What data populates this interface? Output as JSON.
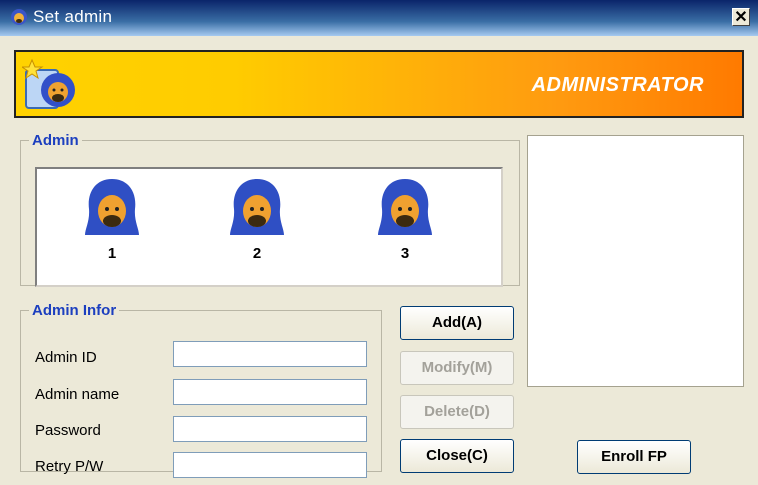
{
  "window": {
    "title": "Set admin",
    "close_glyph": "✕"
  },
  "banner": {
    "text": "ADMINISTRATOR",
    "icon": "admin-user-icon"
  },
  "admin_group": {
    "legend": "Admin",
    "items": [
      {
        "number": "1",
        "icon": "hooded-user-icon"
      },
      {
        "number": "2",
        "icon": "hooded-user-icon"
      },
      {
        "number": "3",
        "icon": "hooded-user-icon"
      }
    ]
  },
  "info_group": {
    "legend": "Admin Infor",
    "fields": [
      {
        "label": "Admin ID",
        "value": ""
      },
      {
        "label": "Admin name",
        "value": ""
      },
      {
        "label": "Password",
        "value": ""
      },
      {
        "label": "Retry P/W",
        "value": ""
      }
    ]
  },
  "buttons": {
    "add": "Add(A)",
    "modify": "Modify(M)",
    "delete": "Delete(D)",
    "close": "Close(C)",
    "enroll": "Enroll FP"
  },
  "colors": {
    "title_bar": "#0a246a",
    "banner_start": "#ffd200",
    "banner_end": "#ff7a00",
    "legend": "#1c3fbf"
  }
}
